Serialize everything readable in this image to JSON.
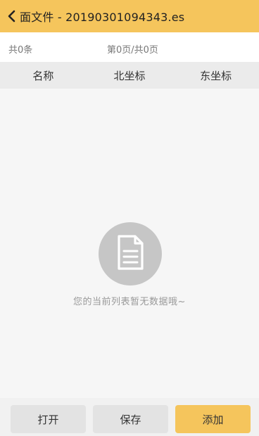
{
  "header": {
    "title": "面文件 - 20190301094343.es",
    "back_icon": "chevron-left-icon",
    "color": "#f5c55c"
  },
  "pager": {
    "count_text": "共0条",
    "page_text": "第0页/共0页"
  },
  "table": {
    "columns": [
      "名称",
      "北坐标",
      "东坐标"
    ],
    "rows": []
  },
  "empty_state": {
    "icon": "document-icon",
    "message": "您的当前列表暂无数据哦~"
  },
  "footer": {
    "buttons": [
      {
        "label": "打开"
      },
      {
        "label": "保存"
      },
      {
        "label": "添加"
      }
    ],
    "accent": "#f5c55c"
  }
}
